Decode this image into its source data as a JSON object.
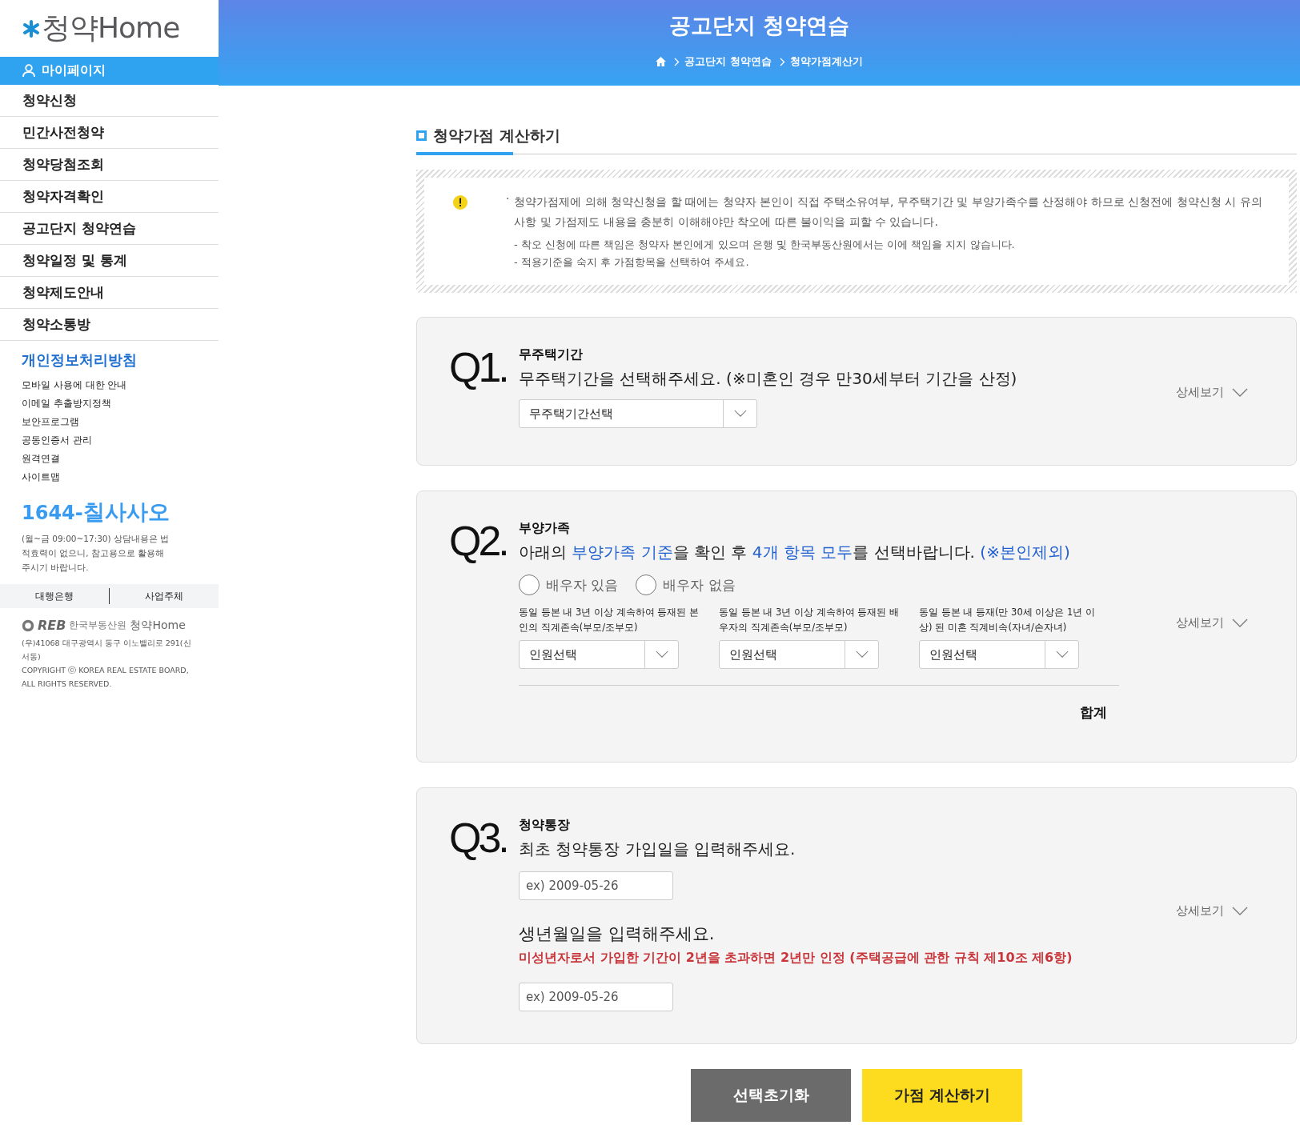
{
  "logo": {
    "text": "청약Home"
  },
  "sidebar": {
    "mypage": "마이페이지",
    "menu": [
      "청약신청",
      "민간사전청약",
      "청약당첨조회",
      "청약자격확인",
      "공고단지 청약연습",
      "청약일정 및 통계",
      "청약제도안내",
      "청약소통방"
    ],
    "policy": "개인정보처리방침",
    "links": [
      "모바일 사용에 대한 안내",
      "이메일 추출방지정책",
      "보안프로그램",
      "공동인증서 관리",
      "원격연결",
      "사이트맵"
    ],
    "phone": {
      "prefix": "1644-",
      "suffix": "칠사사오"
    },
    "hours": "(월~금 09:00~17:30) 상담내용은 법적효력이 없으니, 참고용으로 활용해 주시기 바랍니다.",
    "bottom_tabs": [
      "대행은행",
      "사업주체"
    ],
    "footer": {
      "brand": "REB",
      "org": "한국부동산원",
      "site": "청약Home",
      "address": "(우)41068 대구광역시 동구 이노밸리로 291(신서동)",
      "copyright": "COPYRIGHT ⓒ KOREA REAL ESTATE BOARD, ALL RIGHTS RESERVED."
    }
  },
  "header": {
    "title": "공고단지 청약연습",
    "breadcrumb": [
      "공고단지 청약연습",
      "청약가점계산기"
    ]
  },
  "section_title": "청약가점 계산하기",
  "notice": {
    "bullet": "·",
    "main": "청약가점제에 의해 청약신청을 할 때에는 청약자 본인이 직접 주택소유여부, 무주택기간 및 부양가족수를 산정해야 하므로 신청전에 청약신청 시 유의사항 및 가점제도 내용을 충분히 이해해야만 착오에 따른 불이익을 피할 수 있습니다.",
    "notes": [
      "- 착오 신청에 따른 책임은 청약자 본인에게 있으며 은행 및 한국부동산원에서는 이에 책임을 지지 않습니다.",
      "- 적용기준을 숙지 후 가점항목을 선택하여 주세요."
    ]
  },
  "questions": [
    {
      "kind": "select",
      "number": "Q1.",
      "title": "무주택기간",
      "instruction": [
        {
          "text": "무주택기간을 선택해주세요. (※미혼인 경우 만30세부터 기간을 산정)",
          "highlight": false
        }
      ],
      "detail": "상세보기",
      "select": "무주택기간선택"
    },
    {
      "kind": "family",
      "number": "Q2.",
      "title": "부양가족",
      "instruction": [
        {
          "text": "아래의 ",
          "highlight": false
        },
        {
          "text": "부양가족 기준",
          "highlight": true
        },
        {
          "text": "을 확인 후 ",
          "highlight": false
        },
        {
          "text": "4개 항목 모두",
          "highlight": true
        },
        {
          "text": "를 선택바랍니다. ",
          "highlight": false
        },
        {
          "text": "(※본인제외)",
          "highlight": true
        }
      ],
      "detail": "상세보기",
      "radios": [
        {
          "label": "배우자 있음",
          "selected": false
        },
        {
          "label": "배우자 없음",
          "selected": false
        }
      ],
      "groups": [
        {
          "label": "동일 등본 내 3년 이상 계속하여 등재된 본인의 직계존속(부모/조부모)",
          "select": "인원선택"
        },
        {
          "label": "동일 등본 내 3년 이상 계속하여 등재된 배우자의 직계존속(부모/조부모)",
          "select": "인원선택"
        },
        {
          "label": "동일 등본 내 등재(만 30세 이상은 1년 이상) 된 미혼 직계비속(자녀/손자녀)",
          "select": "인원선택"
        }
      ],
      "total_label": "합계"
    },
    {
      "kind": "dates",
      "number": "Q3.",
      "title": "청약통장",
      "instruction": [
        {
          "text": "최초 청약통장 가입일을 입력해주세요.",
          "highlight": false
        }
      ],
      "detail": "상세보기",
      "placeholder": "ex) 2009-05-26",
      "birth": {
        "prompt": "생년월일을 입력해주세요.",
        "note": "미성년자로서 가입한 기간이 2년을 초과하면 2년만 인정 (주택공급에 관한 규칙 제10조 제6항)",
        "placeholder": "ex) 2009-05-26"
      }
    }
  ],
  "buttons": [
    {
      "kind": "reset",
      "label": "선택초기화"
    },
    {
      "kind": "calculate",
      "label": "가점 계산하기"
    }
  ]
}
